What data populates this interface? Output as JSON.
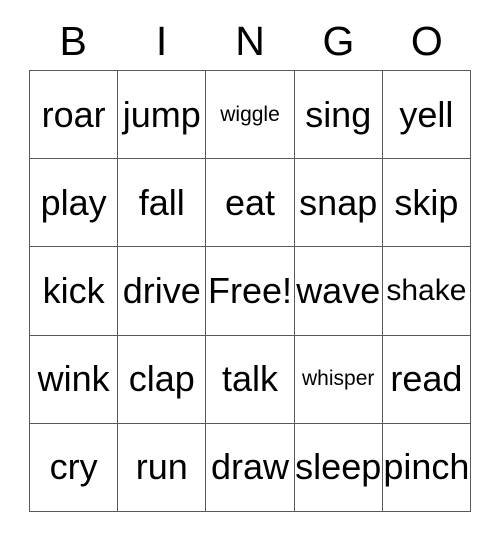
{
  "card": {
    "title": "BINGO",
    "header_letters": [
      "B",
      "I",
      "N",
      "G",
      "O"
    ],
    "grid_size": "5x5",
    "free_space": "Free!",
    "colors": {
      "background": "#ffffff",
      "border": "#595959",
      "text": "#000000"
    },
    "rows": [
      [
        {
          "text": "roar",
          "size": "lg"
        },
        {
          "text": "jump",
          "size": "lg"
        },
        {
          "text": "wiggle",
          "size": "sm"
        },
        {
          "text": "sing",
          "size": "lg"
        },
        {
          "text": "yell",
          "size": "lg"
        }
      ],
      [
        {
          "text": "play",
          "size": "lg"
        },
        {
          "text": "fall",
          "size": "lg"
        },
        {
          "text": "eat",
          "size": "lg"
        },
        {
          "text": "snap",
          "size": "lg"
        },
        {
          "text": "skip",
          "size": "lg"
        }
      ],
      [
        {
          "text": "kick",
          "size": "lg"
        },
        {
          "text": "drive",
          "size": "lg"
        },
        {
          "text": "Free!",
          "size": "lg"
        },
        {
          "text": "wave",
          "size": "lg"
        },
        {
          "text": "shake",
          "size": "md"
        }
      ],
      [
        {
          "text": "wink",
          "size": "lg"
        },
        {
          "text": "clap",
          "size": "lg"
        },
        {
          "text": "talk",
          "size": "lg"
        },
        {
          "text": "whisper",
          "size": "sm"
        },
        {
          "text": "read",
          "size": "lg"
        }
      ],
      [
        {
          "text": "cry",
          "size": "lg"
        },
        {
          "text": "run",
          "size": "lg"
        },
        {
          "text": "draw",
          "size": "lg"
        },
        {
          "text": "sleep",
          "size": "lg"
        },
        {
          "text": "pinch",
          "size": "lg"
        }
      ]
    ]
  }
}
